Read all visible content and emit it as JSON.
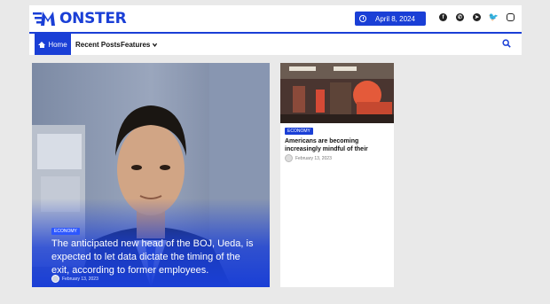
{
  "brand": {
    "logo_letter": "M",
    "logo_text": "ONSTER",
    "accent": "#1a3fd6"
  },
  "header": {
    "date": "April 8, 2024",
    "socials": [
      "facebook-icon",
      "whatsapp-icon",
      "telegram-icon",
      "twitter-icon",
      "instagram-icon"
    ]
  },
  "nav": {
    "home_label": "Home",
    "recent_label": "Recent Posts",
    "features_label": "Features"
  },
  "featured": {
    "category": "ECONOMY",
    "title": "The anticipated new head of the BOJ, Ueda, is expected to let data dictate the timing of the exit, according to former employees.",
    "date": "February 13, 2023"
  },
  "side_post": {
    "category": "ECONOMY",
    "title": "Americans are becoming increasingly mindful of their",
    "date": "February 13, 2023"
  }
}
